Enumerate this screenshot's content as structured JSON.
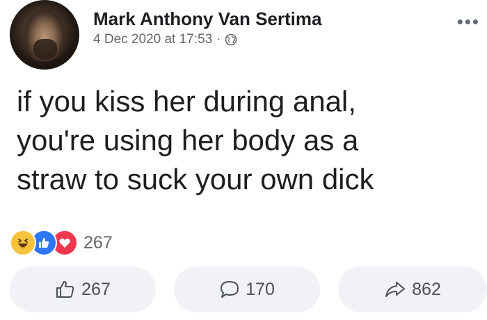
{
  "post": {
    "author_name": "Mark Anthony Van Sertima",
    "timestamp": "4 Dec 2020 at 17:53",
    "separator": "·",
    "privacy_icon": "globe-icon",
    "more_icon": "ellipsis-icon",
    "more_glyph": "•••",
    "text_lines": [
      "if you kiss her during anal,",
      "you're using her body as a",
      "straw to suck your own dick"
    ]
  },
  "reactions": {
    "icons": [
      "haha-reaction-icon",
      "like-reaction-icon",
      "love-reaction-icon"
    ],
    "count": "267",
    "colors": {
      "haha": "#f7c33d",
      "like": "#2e76f5",
      "love": "#f0374f"
    }
  },
  "actions": {
    "like_count": "267",
    "comment_count": "170",
    "share_count": "862",
    "like_icon": "thumbs-up-icon",
    "comment_icon": "speech-bubble-icon",
    "share_icon": "share-arrow-icon",
    "button_bg": "#f0f2f5"
  }
}
